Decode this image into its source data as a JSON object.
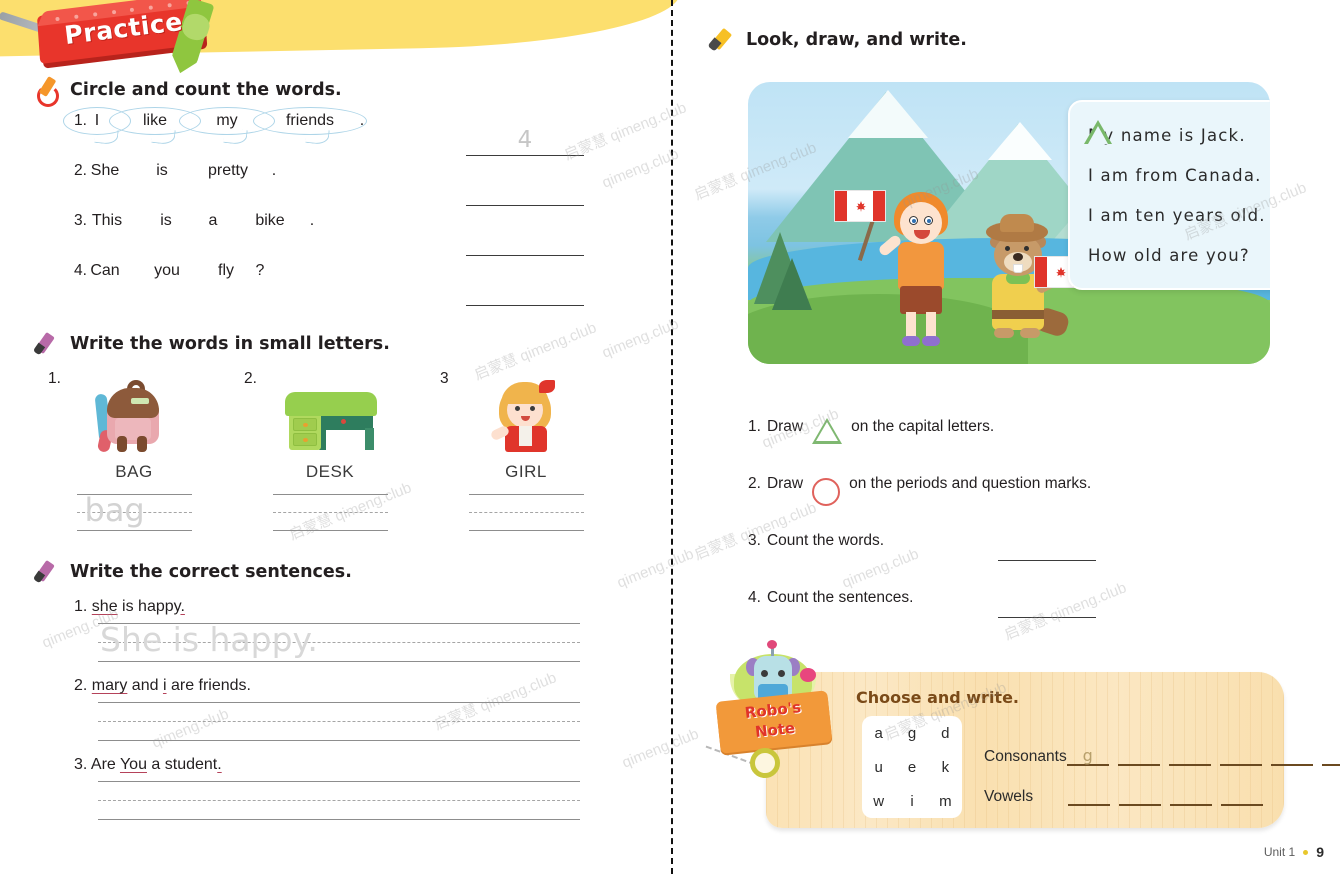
{
  "banner": {
    "label": "Practice"
  },
  "left_page": {
    "ex1": {
      "heading": "Circle and count the words.",
      "rows": [
        {
          "num": "1.",
          "words": [
            "I",
            "like",
            "my",
            "friends"
          ],
          "circled": [
            true,
            true,
            true,
            true
          ],
          "punct": ".",
          "answer": "4"
        },
        {
          "num": "2.",
          "words": [
            "She",
            "is",
            "pretty"
          ],
          "circled": [
            false,
            false,
            false
          ],
          "punct": ".",
          "answer": ""
        },
        {
          "num": "3.",
          "words": [
            "This",
            "is",
            "a",
            "bike"
          ],
          "circled": [
            false,
            false,
            false,
            false
          ],
          "punct": ".",
          "answer": ""
        },
        {
          "num": "4.",
          "words": [
            "Can",
            "you",
            "fly"
          ],
          "circled": [
            false,
            false,
            false
          ],
          "punct": "?",
          "answer": ""
        }
      ]
    },
    "ex2": {
      "heading": "Write the words in small letters.",
      "items": [
        {
          "num": "1.",
          "picture": "backpack-image",
          "word": "BAG",
          "trace": "bag"
        },
        {
          "num": "2.",
          "picture": "desk-image",
          "word": "DESK",
          "trace": ""
        },
        {
          "num": "3",
          "picture": "girl-image",
          "word": "GIRL",
          "trace": ""
        }
      ]
    },
    "ex3": {
      "heading": "Write the correct sentences.",
      "items": [
        {
          "num": "1.",
          "parts": [
            {
              "t": "she",
              "err": true
            },
            {
              "t": " is happy",
              "err": false
            },
            {
              "t": ".",
              "err": true
            }
          ],
          "trace": "She is happy."
        },
        {
          "num": "2.",
          "parts": [
            {
              "t": "mary",
              "err": true
            },
            {
              "t": " and ",
              "err": false
            },
            {
              "t": "i",
              "err": true
            },
            {
              "t": " are friends.",
              "err": false
            }
          ],
          "trace": ""
        },
        {
          "num": "3.",
          "parts": [
            {
              "t": "Are ",
              "err": false
            },
            {
              "t": "You",
              "err": true
            },
            {
              "t": " a student",
              "err": false
            },
            {
              "t": ".",
              "err": true
            }
          ],
          "trace": ""
        }
      ]
    }
  },
  "right_page": {
    "heading": "Look, draw, and write.",
    "scene": {
      "alt": "boy-and-beaver-with-canada-flags-illustration",
      "bubble_lines": [
        "My name is Jack.",
        "I am from Canada.",
        "I am ten years old.",
        "How old are you?"
      ]
    },
    "steps": [
      {
        "num": "1.",
        "pre": "Draw",
        "mark": "triangle",
        "post": "on the capital letters.",
        "blank": false
      },
      {
        "num": "2.",
        "pre": "Draw",
        "mark": "circle",
        "post": "on the periods and question marks.",
        "blank": false
      },
      {
        "num": "3.",
        "pre": "Count the words.",
        "mark": "",
        "post": "",
        "blank": true
      },
      {
        "num": "4.",
        "pre": "Count the sentences.",
        "mark": "",
        "post": "",
        "blank": true
      }
    ],
    "robo": {
      "tag_line1": "Robo's",
      "tag_line2": "Note",
      "title": "Choose and write.",
      "letters": [
        "a",
        "g",
        "d",
        "u",
        "e",
        "k",
        "w",
        "i",
        "m"
      ],
      "rows": [
        {
          "label": "Consonants",
          "filled": [
            "g",
            "",
            "",
            "",
            "",
            ""
          ]
        },
        {
          "label": "Vowels",
          "filled": [
            "",
            "",
            "",
            ""
          ]
        }
      ]
    },
    "footer": {
      "unit": "Unit 1",
      "page": "9"
    }
  },
  "watermark": {
    "cn": "启蒙慧",
    "en": "qimeng.club"
  },
  "colors": {
    "banner_red": "#e8352b",
    "yellow_band": "#fcdf6e",
    "circle_blue": "#aed5e8",
    "error_underline": "#b5425a",
    "mark_green": "#7fb871",
    "mark_red": "#e0625c",
    "robo_card": "#fbe2b4"
  }
}
